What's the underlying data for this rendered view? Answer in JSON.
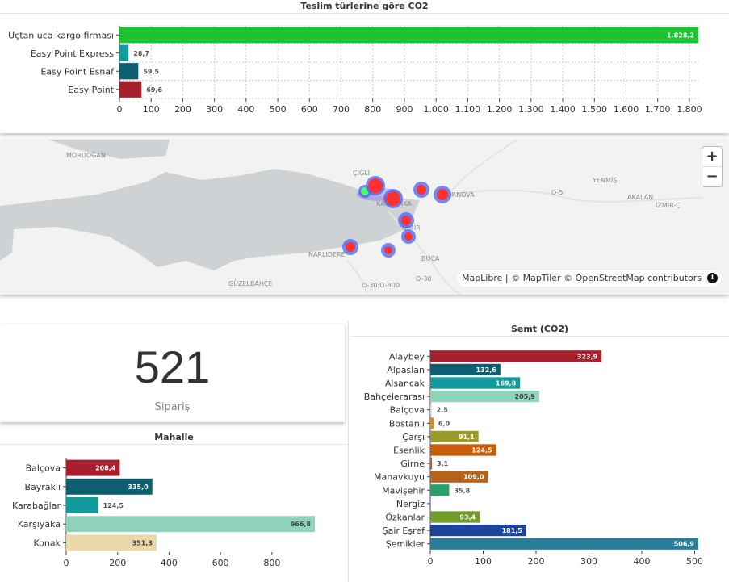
{
  "colors": {
    "green": "#1dc233",
    "teal": "#139a9c",
    "petrol": "#0d5f71",
    "crimson": "#a61f2c",
    "navy": "#1e439a",
    "mint": "#8fd3bb",
    "sand": "#ead8a8",
    "orange": "#e8800c",
    "olive": "#999a2a",
    "rust": "#c65d0a",
    "brown": "#b5631b",
    "seagreen": "#2aa267",
    "moss": "#709a2a",
    "ocean": "#2a7e9c",
    "lightgray": "#cccccc"
  },
  "chart_data": [
    {
      "id": "delivery",
      "type": "bar",
      "orientation": "horizontal",
      "title": "Teslim türlerine göre CO2",
      "categories": [
        "Uçtan uca kargo firması",
        "Easy Point Express",
        "Easy Point Esnaf",
        "Easy Point"
      ],
      "values": [
        1828.2,
        28.7,
        59.5,
        69.6
      ],
      "value_labels": [
        "1.828,2",
        "28,7",
        "59,5",
        "69,6"
      ],
      "bar_colors": [
        "#1dc233",
        "#139a9c",
        "#0d5f71",
        "#a61f2c"
      ],
      "xlim": [
        0,
        1828.2
      ],
      "ticks": [
        0,
        100,
        200,
        300,
        400,
        500,
        600,
        700,
        800,
        900,
        1000,
        1100,
        1200,
        1300,
        1400,
        1500,
        1600,
        1700,
        1800
      ],
      "tick_labels": [
        "0",
        "100",
        "200",
        "300",
        "400",
        "500",
        "600",
        "700",
        "800",
        "900",
        "1.000",
        "1.100",
        "1.200",
        "1.300",
        "1.400",
        "1.500",
        "1.600",
        "1.700",
        "1.800"
      ],
      "grid": true
    },
    {
      "id": "mahalle",
      "type": "bar",
      "orientation": "horizontal",
      "title": "Mahalle",
      "categories": [
        "Balçova",
        "Bayraklı",
        "Karabağlar",
        "Karşıyaka",
        "Konak"
      ],
      "values": [
        208.4,
        335.0,
        124.5,
        966.8,
        351.3
      ],
      "value_labels": [
        "208,4",
        "335,0",
        "124,5",
        "966,8",
        "351,3"
      ],
      "bar_colors": [
        "#a61f2c",
        "#0d5f71",
        "#139a9c",
        "#8fd3bb",
        "#ead8a8"
      ],
      "xlim": [
        0,
        966.8
      ],
      "ticks": [
        0,
        200,
        400,
        600,
        800
      ],
      "tick_labels": [
        "0",
        "200",
        "400",
        "600",
        "800"
      ],
      "grid": false
    },
    {
      "id": "semt",
      "type": "bar",
      "orientation": "horizontal",
      "title": "Semt (CO2)",
      "categories": [
        "Alaybey",
        "Alpaslan",
        "Alsancak",
        "Bahçelerarası",
        "Balçova",
        "Bostanlı",
        "Çarşı",
        "Esenlik",
        "Girne",
        "Manavkuyu",
        "Mavişehir",
        "Nergiz",
        "Özkanlar",
        "Şair Eşref",
        "Şemikler"
      ],
      "values": [
        323.9,
        132.6,
        169.8,
        205.9,
        2.5,
        6.0,
        91.1,
        124.5,
        3.1,
        109.0,
        35.8,
        0,
        93.4,
        181.5,
        506.9
      ],
      "value_labels": [
        "323,9",
        "132,6",
        "169,8",
        "205,9",
        "2,5",
        "6,0",
        "91,1",
        "124,5",
        "3,1",
        "109,0",
        "35,8",
        "",
        "93,4",
        "181,5",
        "506,9"
      ],
      "bar_colors": [
        "#a61f2c",
        "#0d5f71",
        "#139a9c",
        "#8fd3bb",
        "#cccccc",
        "#e8800c",
        "#999a2a",
        "#c65d0a",
        "#b5631b",
        "#b5631b",
        "#2aa267",
        "#cccccc",
        "#709a2a",
        "#1e439a",
        "#2a7e9c"
      ],
      "xlim": [
        0,
        506.9
      ],
      "ticks": [
        0,
        100,
        200,
        300,
        400,
        500
      ],
      "tick_labels": [
        "0",
        "100",
        "200",
        "300",
        "400",
        "500"
      ],
      "grid": false
    }
  ],
  "map": {
    "places": [
      "MORDOĞAN",
      "ÇİĞLİ",
      "KARŞIYAKA",
      "BORNOVA",
      "İZMİR",
      "NARLIDERE",
      "BUCA",
      "GÜZELBAHÇE",
      "YENMİŞ",
      "AKALAN",
      "İZMİR-Ç",
      "O-5",
      "O-30",
      "O-30;O-300"
    ],
    "attribution": "MapLibre | © MapTiler © OpenStreetMap contributors",
    "info_icon": "info-icon",
    "zoom_in": "+",
    "zoom_out": "−"
  },
  "kpi": {
    "value": "521",
    "label": "Sipariş"
  }
}
